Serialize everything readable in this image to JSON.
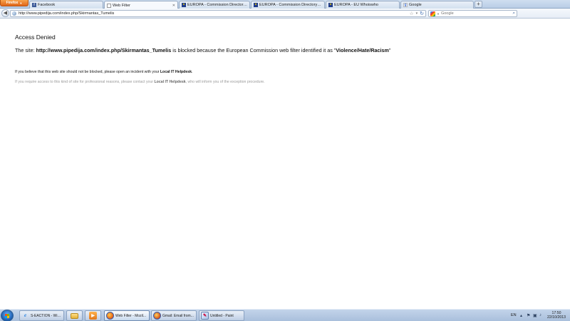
{
  "browser": {
    "menu_button_label": "Firefox",
    "tabs": [
      {
        "label": "Facebook",
        "icon": "facebook-icon"
      },
      {
        "label": "Web Filter",
        "icon": "blank-page-icon",
        "active": true
      },
      {
        "label": "EUROPA - Commission Directory - W...",
        "icon": "eu-flag-icon"
      },
      {
        "label": "EUROPA - Commission Directory - O...",
        "icon": "eu-flag-icon"
      },
      {
        "label": "EUROPA - EU Whoiswho",
        "icon": "eu-flag-icon"
      },
      {
        "label": "Google",
        "icon": "google-icon"
      }
    ],
    "new_tab_label": "+",
    "url": "http://www.pipedija.com/index.php/Skirmantas_Tumelis",
    "search_placeholder": "Google"
  },
  "page": {
    "title": "Access Denied",
    "message": {
      "prefix": "The site: ",
      "site": "http://www.pipedija.com/index.php/Skirmantas_Tumelis",
      "middle": " is blocked because the European Commission web filter identified it as \"",
      "category": "Violence/Hate/Racism",
      "suffix": "\""
    },
    "info1": {
      "text": "If you believe that this web site should not be blocked, please open an incident with your ",
      "bold": "Local IT Helpdesk",
      "end": "."
    },
    "info2": {
      "text": "If you require access to this kind of site for professional reasons, please contact your ",
      "bold": "Local IT Helpdesk",
      "end": ", who will inform you of the exception procedure."
    }
  },
  "taskbar": {
    "items": [
      {
        "label": "S-EACTION - Win...",
        "icon": "internet-explorer-icon"
      },
      {
        "label": "",
        "icon": "folder-icon"
      },
      {
        "label": "",
        "icon": "media-player-icon"
      },
      {
        "label": "Web Filter - Mozil...",
        "icon": "firefox-icon",
        "active": true
      },
      {
        "label": "Gmail: Email from...",
        "icon": "firefox-icon"
      },
      {
        "label": "Untitled - Paint",
        "icon": "paint-icon"
      }
    ],
    "language": "EN",
    "time": "17:50",
    "date": "22/10/2013"
  },
  "colors": {
    "firefox_orange": "#e0661a",
    "muted_text": "#999999",
    "taskbar_blue": "#a9bfdc"
  }
}
